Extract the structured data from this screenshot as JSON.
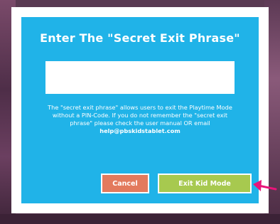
{
  "dialog": {
    "title": "Enter The \"Secret Exit Phrase\"",
    "input_value": "",
    "input_placeholder": "",
    "help_text": "The \"secret exit phrase\" allows users to exit the Playtime Mode without a PIN-Code. If you do not remember the \"secret exit phrase\" please check the user manual OR email",
    "help_email": "help@pbskidstablet.com",
    "cancel_label": "Cancel",
    "exit_label": "Exit Kid Mode"
  },
  "colors": {
    "dialog_background": "#20b3e8",
    "cancel_button": "#e37a5d",
    "exit_button": "#a7c94f",
    "annotation_arrow": "#e8147a"
  },
  "icons": {
    "annotation": "arrow-left-icon"
  }
}
